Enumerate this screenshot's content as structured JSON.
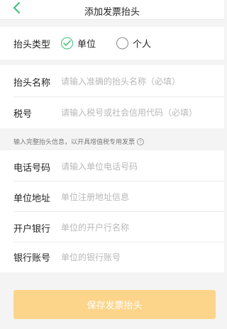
{
  "header": {
    "title": "添加发票抬头",
    "back_icon": "chevron-left-icon"
  },
  "invoice_type": {
    "label": "抬头类型",
    "options": [
      {
        "label": "单位",
        "selected": true
      },
      {
        "label": "个人",
        "selected": false
      }
    ]
  },
  "fields_primary": [
    {
      "label": "抬头名称",
      "placeholder": "请输入准确的抬头名称（必填）"
    },
    {
      "label": "税号",
      "placeholder": "请输入税号或社会信用代码（必填）"
    }
  ],
  "notice": {
    "text": "输入完整抬头信息，以开具增值税专用发票",
    "icon": "question-circle-icon"
  },
  "fields_secondary": [
    {
      "label": "电话号码",
      "placeholder": "请输入单位电话号码"
    },
    {
      "label": "单位地址",
      "placeholder": "单位注册地址信息"
    },
    {
      "label": "开户银行",
      "placeholder": "单位的开户行名称"
    },
    {
      "label": "银行账号",
      "placeholder": "单位的银行账号"
    }
  ],
  "save_button": {
    "label": "保存发票抬头"
  },
  "colors": {
    "accent_green": "#3bbf7a",
    "button_bg": "#fdd58a",
    "placeholder": "#b8b8b8"
  }
}
